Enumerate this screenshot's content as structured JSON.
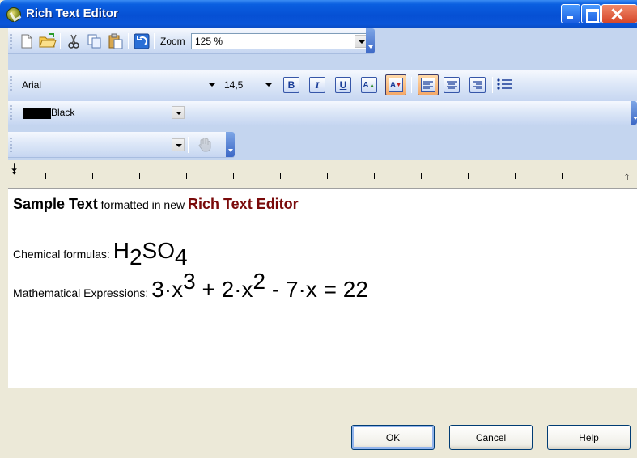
{
  "window": {
    "title": "Rich Text Editor"
  },
  "toolbar_main": {
    "icons": [
      "new-document-icon",
      "open-folder-icon",
      "cut-icon",
      "copy-icon",
      "paste-icon",
      "undo-icon"
    ],
    "zoom_label": "Zoom",
    "zoom_value": "125 %"
  },
  "toolbar_format": {
    "font_name": "Arial",
    "font_size": "14,5",
    "bold": "B",
    "italic": "I",
    "underline": "U",
    "grow_font": "A",
    "shrink_font": "A",
    "align_left_active": true
  },
  "toolbar_color": {
    "color_name": "Black",
    "color_hex": "#000000"
  },
  "toolbar_style": {
    "style_value": ""
  },
  "content": {
    "line1": {
      "sample_text": "Sample Text",
      "formatted_in": " formatted in new ",
      "rte": "Rich Text Editor"
    },
    "line2": {
      "label": "Chemical formulas: ",
      "h": "H",
      "sub2": "2",
      "so": "SO",
      "sub4": "4"
    },
    "line3": {
      "label": "Mathematical Expressions: ",
      "part1": "3·x",
      "sup3": "3",
      "part2": " + 2·x",
      "sup2": "2",
      "part3": " - 7·x = 22"
    }
  },
  "buttons": {
    "ok": "OK",
    "cancel": "Cancel",
    "help": "Help"
  },
  "colors": {
    "title_bar": "#0a55d8",
    "toolbar_bg": "#c4d5ef",
    "accent_red": "#7a0a0a",
    "active_button": "#f4a868"
  }
}
